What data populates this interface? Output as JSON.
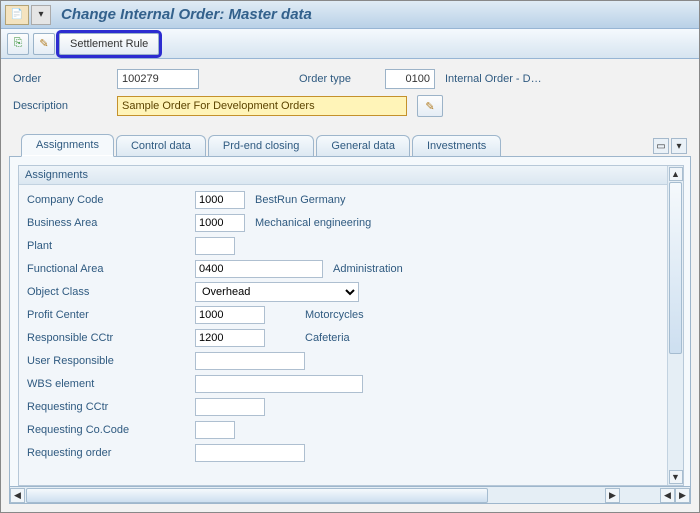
{
  "title": "Change Internal Order: Master data",
  "toolbar": {
    "settlement_rule": "Settlement Rule"
  },
  "header": {
    "order_label": "Order",
    "order_value": "100279",
    "order_type_label": "Order type",
    "order_type_value": "0100",
    "order_type_text": "Internal Order - D…",
    "description_label": "Description",
    "description_value": "Sample Order For Development Orders"
  },
  "tabs": {
    "assignments": "Assignments",
    "control_data": "Control data",
    "prd_end_closing": "Prd-end closing",
    "general_data": "General data",
    "investments": "Investments"
  },
  "section": {
    "title": "Assignments",
    "fields": {
      "company_code": {
        "label": "Company Code",
        "value": "1000",
        "text": "BestRun Germany"
      },
      "business_area": {
        "label": "Business Area",
        "value": "1000",
        "text": "Mechanical engineering"
      },
      "plant": {
        "label": "Plant",
        "value": "",
        "text": ""
      },
      "functional_area": {
        "label": "Functional Area",
        "value": "0400",
        "text": "Administration"
      },
      "object_class": {
        "label": "Object Class",
        "value": "Overhead"
      },
      "profit_center": {
        "label": "Profit Center",
        "value": "1000",
        "text": "Motorcycles"
      },
      "responsible_cctr": {
        "label": "Responsible CCtr",
        "value": "1200",
        "text": "Cafeteria"
      },
      "user_responsible": {
        "label": "User Responsible",
        "value": "",
        "text": ""
      },
      "wbs_element": {
        "label": "WBS element",
        "value": "",
        "text": ""
      },
      "requesting_cctr": {
        "label": "Requesting CCtr",
        "value": "",
        "text": ""
      },
      "requesting_cocode": {
        "label": "Requesting Co.Code",
        "value": "",
        "text": ""
      },
      "requesting_order": {
        "label": "Requesting order",
        "value": "",
        "text": ""
      }
    }
  }
}
